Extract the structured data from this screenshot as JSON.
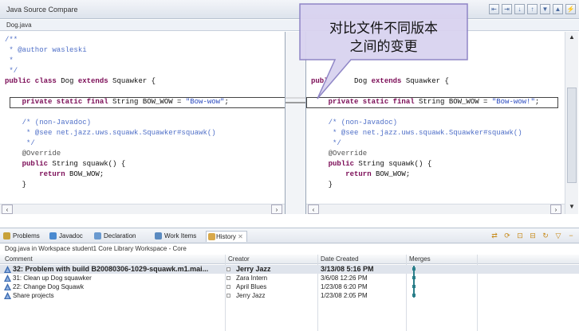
{
  "window": {
    "title": "Java Source Compare",
    "file_tab": "Dog.java"
  },
  "callout": {
    "line1": "对比文件不同版本",
    "line2": "之间的变更"
  },
  "left_code": {
    "lines": [
      {
        "cls": "cm",
        "text": "/**"
      },
      {
        "cls": "cm",
        "text": " * @author wasleski"
      },
      {
        "cls": "cm",
        "text": " *"
      },
      {
        "cls": "cm",
        "text": " */"
      },
      {
        "cls": "mix",
        "parts": [
          [
            "kw",
            "public class"
          ],
          [
            "plain",
            " Dog "
          ],
          [
            "kw",
            "extends"
          ],
          [
            "plain",
            " Squawker {"
          ]
        ]
      },
      {
        "cls": "plain",
        "text": ""
      },
      {
        "cls": "mix",
        "parts": [
          [
            "kw",
            "    private static final"
          ],
          [
            "plain",
            " String BOW_WOW = "
          ],
          [
            "st",
            "\"Bow-wow\""
          ],
          [
            "plain",
            ";"
          ]
        ]
      },
      {
        "cls": "plain",
        "text": ""
      },
      {
        "cls": "cm",
        "text": "    /* (non-Javadoc)"
      },
      {
        "cls": "cm",
        "text": "     * @see net.jazz.uws.squawk.Squawker#squawk()"
      },
      {
        "cls": "cm",
        "text": "     */"
      },
      {
        "cls": "an",
        "text": "    @Override"
      },
      {
        "cls": "mix",
        "parts": [
          [
            "kw",
            "    public"
          ],
          [
            "plain",
            " String squawk() {"
          ]
        ]
      },
      {
        "cls": "mix",
        "parts": [
          [
            "kw",
            "        return"
          ],
          [
            "plain",
            " BOW_WOW;"
          ]
        ]
      },
      {
        "cls": "plain",
        "text": "    }"
      },
      {
        "cls": "plain",
        "text": ""
      },
      {
        "cls": "plain",
        "text": ""
      },
      {
        "cls": "plain",
        "text": "}"
      }
    ]
  },
  "right_code": {
    "lines": [
      {
        "cls": "plain",
        "text": ""
      },
      {
        "cls": "plain",
        "text": ""
      },
      {
        "cls": "plain",
        "text": ""
      },
      {
        "cls": "plain",
        "text": ""
      },
      {
        "cls": "mix",
        "parts": [
          [
            "kw",
            "publ"
          ],
          [
            "plain",
            "      Dog "
          ],
          [
            "kw",
            "extends"
          ],
          [
            "plain",
            " Squawker {"
          ]
        ]
      },
      {
        "cls": "plain",
        "text": ""
      },
      {
        "cls": "mix",
        "parts": [
          [
            "kw",
            "    private static final"
          ],
          [
            "plain",
            " String BOW_WOW = "
          ],
          [
            "st",
            "\"Bow-wow!\""
          ],
          [
            "plain",
            ";"
          ]
        ]
      },
      {
        "cls": "plain",
        "text": ""
      },
      {
        "cls": "cm",
        "text": "    /* (non-Javadoc)"
      },
      {
        "cls": "cm",
        "text": "     * @see net.jazz.uws.squawk.Squawker#squawk()"
      },
      {
        "cls": "cm",
        "text": "     */"
      },
      {
        "cls": "an",
        "text": "    @Override"
      },
      {
        "cls": "mix",
        "parts": [
          [
            "kw",
            "    public"
          ],
          [
            "plain",
            " String squawk() {"
          ]
        ]
      },
      {
        "cls": "mix",
        "parts": [
          [
            "kw",
            "        return"
          ],
          [
            "plain",
            " BOW_WOW;"
          ]
        ]
      },
      {
        "cls": "plain",
        "text": "    }"
      },
      {
        "cls": "plain",
        "text": ""
      },
      {
        "cls": "plain",
        "text": ""
      },
      {
        "cls": "plain",
        "text": "}"
      }
    ]
  },
  "bottom_tabs": [
    {
      "label": "Problems",
      "icon": "problems-icon",
      "color": "#c8a23a"
    },
    {
      "label": "Javadoc",
      "icon": "javadoc-icon",
      "color": "#4a8ad0"
    },
    {
      "label": "Declaration",
      "icon": "declaration-icon",
      "color": "#6a9ad0"
    },
    {
      "label": "Work Items",
      "icon": "work-items-icon",
      "color": "#5a8ac0"
    },
    {
      "label": "History",
      "icon": "history-icon",
      "color": "#d8a84a",
      "active": true
    }
  ],
  "history": {
    "info": "Dog.java in Workspace student1 Core Library Workspace - Core",
    "columns": [
      "Comment",
      "Creator",
      "Date Created",
      "Merges"
    ],
    "rows": [
      {
        "comment": "32: Problem with build B20080306-1029-squawk.m1.mai...",
        "creator": "Jerry Jazz",
        "date": "3/13/08 5:16 PM",
        "selected": true
      },
      {
        "comment": "31: Clean up Dog squawker",
        "creator": "Zara Intern",
        "date": "3/6/08 12:26 PM"
      },
      {
        "comment": "22: Change Dog Squawk",
        "creator": "April Blues",
        "date": "1/23/08 6:20 PM"
      },
      {
        "comment": "Share projects",
        "creator": "Jerry Jazz",
        "date": "1/23/08 2:05 PM"
      }
    ]
  },
  "colors": {
    "callout_fill": "#d9d3f0",
    "callout_border": "#8a80c4",
    "merge": "#2a7f8a"
  }
}
